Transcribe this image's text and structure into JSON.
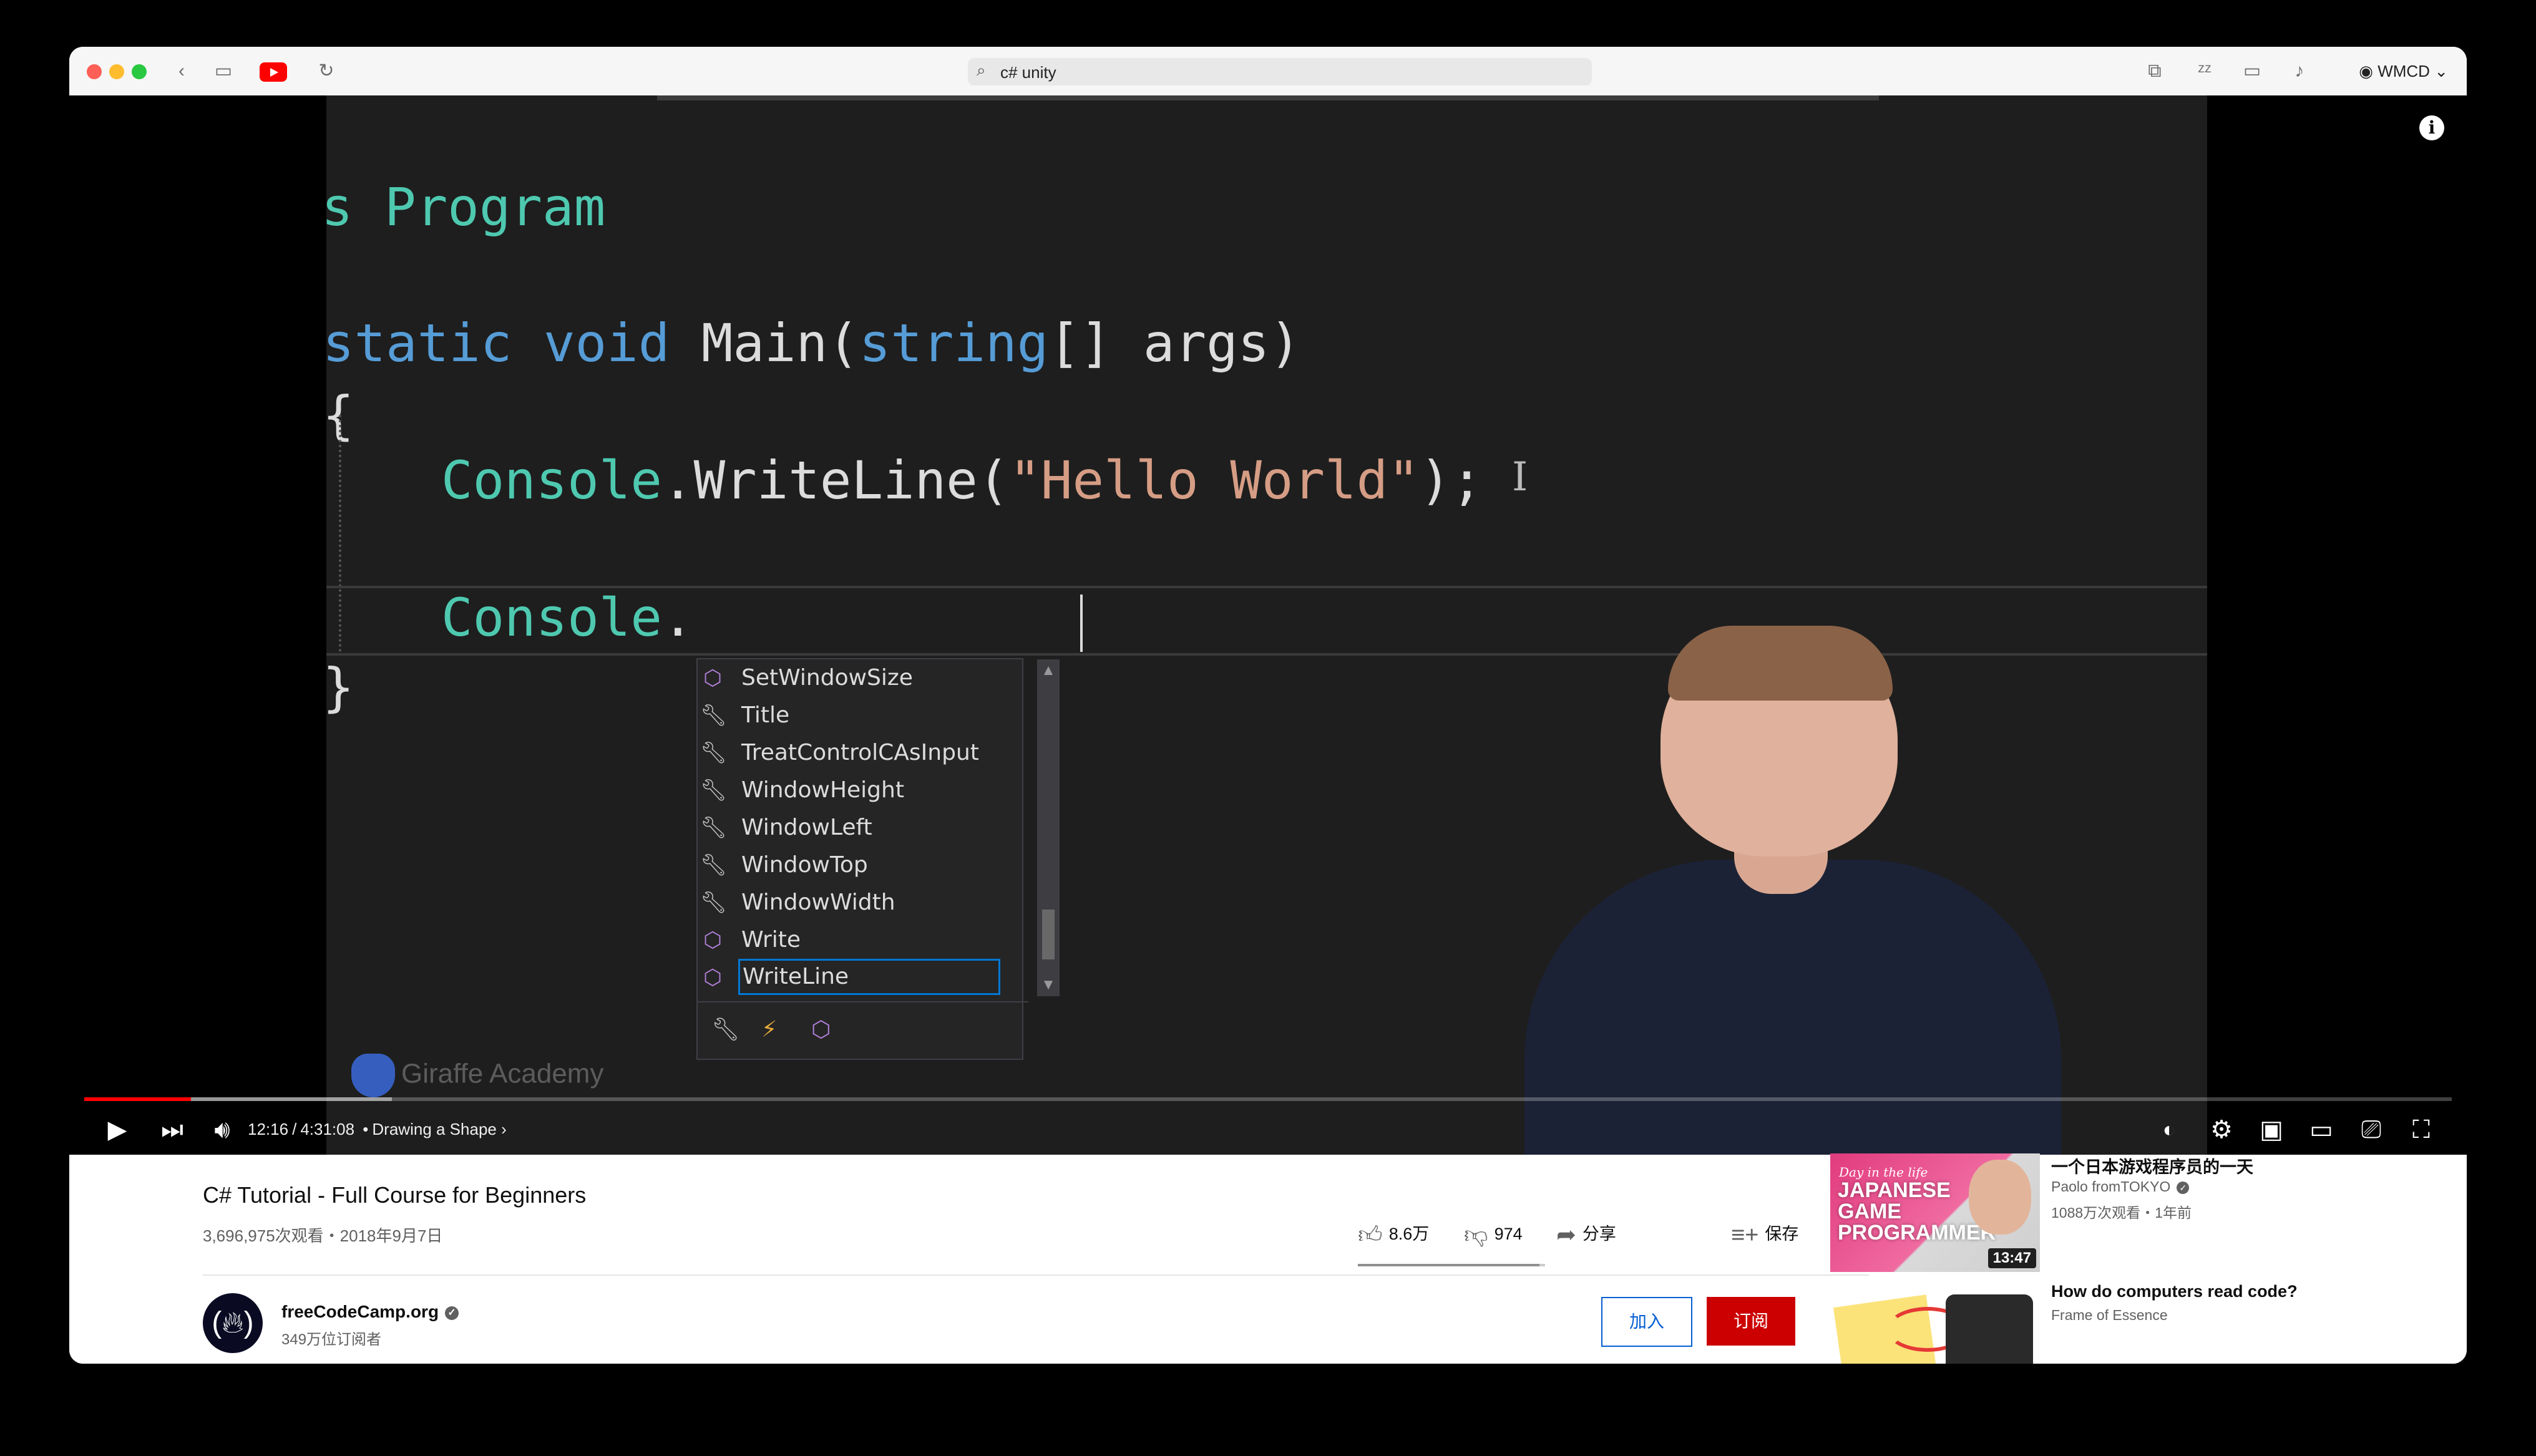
{
  "browser": {
    "url": "c# unity",
    "profile": "WMCD"
  },
  "code": {
    "line1": "s Program",
    "main_static": "static",
    "main_void": "void",
    "main_name": "Main(",
    "main_string": "string",
    "main_rest": "[] args)",
    "brace_open": "{",
    "l3_console": "Console",
    "l3_call": ".WriteLine(",
    "l3_str": "\"Hello World\"",
    "l3_end": ");",
    "l4_console": "Console",
    "l4_dot": ".",
    "brace_close": "}"
  },
  "completion": {
    "items": [
      {
        "label": "SetWindowSize",
        "kind": "method-icon"
      },
      {
        "label": "Title",
        "kind": "wrench-icon"
      },
      {
        "label": "TreatControlCAsInput",
        "kind": "wrench-icon"
      },
      {
        "label": "WindowHeight",
        "kind": "wrench-icon"
      },
      {
        "label": "WindowLeft",
        "kind": "wrench-icon"
      },
      {
        "label": "WindowTop",
        "kind": "wrench-icon"
      },
      {
        "label": "WindowWidth",
        "kind": "wrench-icon"
      },
      {
        "label": "Write",
        "kind": "method-icon"
      },
      {
        "label": "WriteLine",
        "kind": "method-icon",
        "selected": true
      }
    ],
    "scroll_position": 0.86
  },
  "watermark": "Giraffe Academy",
  "player": {
    "current_time": "12:16",
    "duration": "4:31:08",
    "chapter": "Drawing a Shape",
    "played_fraction": 0.045,
    "buffered_fraction": 0.13
  },
  "video": {
    "title": "C# Tutorial - Full Course for Beginners",
    "meta": "3,696,975次观看・2018年9月7日",
    "likes": "8.6万",
    "dislikes": "974",
    "share": "分享",
    "save": "保存",
    "like_ratio": 0.97
  },
  "channel": {
    "name": "freeCodeCamp.org",
    "subscribers": "349万位订阅者",
    "join_label": "加入",
    "subscribe_label": "订阅"
  },
  "recommendations": [
    {
      "title": "一个日本游戏程序员的一天",
      "channel": "Paolo fromTOKYO",
      "meta": "1088万次观看・1年前",
      "duration": "13:47",
      "thumb_tag": "Day in the life",
      "thumb_text": "JAPANESE GAME PROGRAMMER"
    },
    {
      "title": "How do computers read code?",
      "channel": "Frame of Essence"
    }
  ],
  "colors": {
    "youtube_red": "#ff0000",
    "subscribe_red": "#cc0000",
    "join_blue": "#065fd4",
    "code_keyword": "#569cd6",
    "code_class": "#4ec9b0",
    "code_string": "#d69d85"
  }
}
